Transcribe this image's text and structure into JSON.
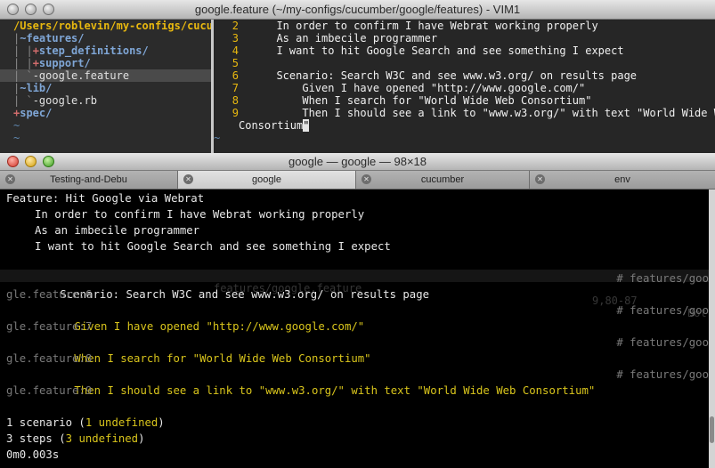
{
  "vim": {
    "title": "google.feature (~/my-configs/cucumber/google/features) - VIM1",
    "tree": {
      "root": "/Users/roblevin/my-configs/cucu",
      "items": [
        {
          "prefix": "|",
          "mark": "~",
          "name": "features/",
          "kind": "dir"
        },
        {
          "prefix": "| |",
          "mark": "+",
          "name": "step_definitions/",
          "kind": "dir"
        },
        {
          "prefix": "| |",
          "mark": "+",
          "name": "support/",
          "kind": "dir"
        },
        {
          "prefix": "| `",
          "mark": "-",
          "name": "google.feature",
          "kind": "file"
        },
        {
          "prefix": "|",
          "mark": "~",
          "name": "lib/",
          "kind": "dir"
        },
        {
          "prefix": "| `",
          "mark": "-",
          "name": "google.rb",
          "kind": "file"
        },
        {
          "prefix": "",
          "mark": "+",
          "name": "spec/",
          "kind": "dir"
        }
      ]
    },
    "lines": [
      {
        "num": "2",
        "text": "  In order to confirm I have Webrat working properly"
      },
      {
        "num": "3",
        "text": "  As an imbecile programmer"
      },
      {
        "num": "4",
        "text": "  I want to hit Google Search and see something I expect"
      },
      {
        "num": "5",
        "text": ""
      },
      {
        "num": "6",
        "text": "  Scenario: Search W3C and see www.w3.org/ on results page"
      },
      {
        "num": "7",
        "text": "      Given I have opened \"http://www.google.com/\""
      },
      {
        "num": "8",
        "text": "      When I search for \"World Wide Web Consortium\""
      },
      {
        "num": "9",
        "text": "      Then I should see a link to \"www.w3.org/\" with text \"World Wide Web"
      }
    ],
    "wrap_text": "Consortium",
    "wrap_cursor": "\"",
    "tilde": "~",
    "ghost_status": {
      "file": "features/google.feature",
      "pos": "9,80-87",
      "where": "Bot"
    }
  },
  "terminal": {
    "title": "google — google — 98×18",
    "tabs": [
      {
        "label": "Testing-and-Debu",
        "active": false
      },
      {
        "label": "google",
        "active": true
      },
      {
        "label": "cucumber",
        "active": false
      },
      {
        "label": "env",
        "active": false
      }
    ],
    "feature_line": "Feature: Hit Google via Webrat",
    "narrative": [
      "In order to confirm I have Webrat working properly",
      "As an imbecile programmer",
      "I want to hit Google Search and see something I expect"
    ],
    "scenario_line": "Scenario: Search W3C and see www.w3.org/ on results page",
    "scenario_ref": "# features/goo",
    "scenario_ref_wrap": "gle.feature:6",
    "steps": [
      {
        "text": "Given I have opened \"http://www.google.com/\"",
        "ref": "# features/goo",
        "wrap": "gle.feature:7"
      },
      {
        "text": "When I search for \"World Wide Web Consortium\"",
        "ref": "# features/goo",
        "wrap": "gle.feature:8"
      },
      {
        "text": "Then I should see a link to \"www.w3.org/\" with text \"World Wide Web Consortium\"",
        "ref": "# features/goo",
        "wrap": "gle.feature:9"
      }
    ],
    "summary": {
      "scenarios_count": "1 scenario (",
      "scenarios_undef": "1 undefined",
      "steps_count": "3 steps (",
      "steps_undef": "3 undefined",
      "close_paren": ")",
      "time": "0m0.003s"
    }
  },
  "colors": {
    "yellow": "#d9c51c",
    "vim_linenr": "#e8b80f",
    "tree_dir": "#7fa6d6",
    "tree_plus": "#d06c6c"
  }
}
